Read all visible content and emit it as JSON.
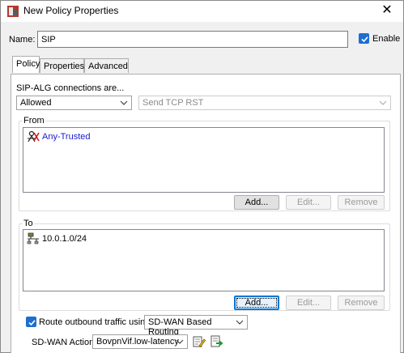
{
  "window": {
    "title": "New Policy Properties",
    "close_glyph": "✕"
  },
  "name_field": {
    "label": "Name:",
    "value": "SIP"
  },
  "enable": {
    "label": "Enable",
    "checked": true
  },
  "tabs": [
    {
      "label": "Policy",
      "active": true
    },
    {
      "label": "Properties",
      "active": false
    },
    {
      "label": "Advanced",
      "active": false
    }
  ],
  "policy": {
    "connections_label": "SIP-ALG connections are...",
    "action_select": "Allowed",
    "reset_select": "Send TCP RST",
    "from_group": {
      "legend": "From",
      "entries": [
        {
          "label": "Any-Trusted",
          "icon": "any-trusted-icon"
        }
      ],
      "buttons": {
        "add": "Add...",
        "edit": "Edit...",
        "remove": "Remove"
      }
    },
    "to_group": {
      "legend": "To",
      "entries": [
        {
          "label": "10.0.1.0/24",
          "icon": "network-icon"
        }
      ],
      "buttons": {
        "add": "Add...",
        "edit": "Edit...",
        "remove": "Remove"
      }
    },
    "route": {
      "checkbox_label": "Route outbound traffic using",
      "checked": true,
      "routing_select": "SD-WAN Based Routing"
    },
    "sdwan": {
      "label": "SD-WAN Action",
      "action_select": "BovpnVif.low-latency"
    }
  },
  "colors": {
    "accent": "#1c6fd1",
    "link": "#1b1bd0"
  }
}
